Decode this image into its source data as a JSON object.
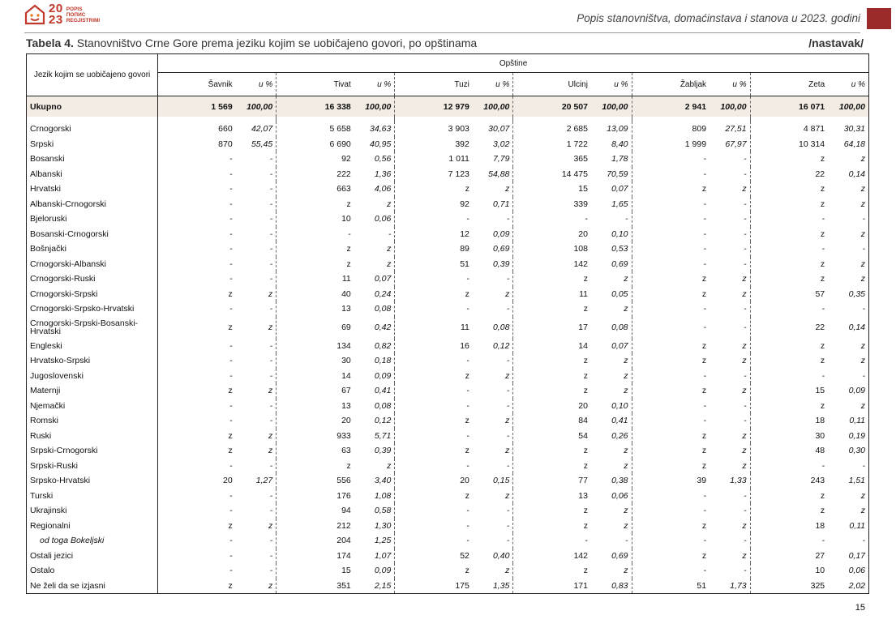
{
  "logo": {
    "year_top": "20",
    "year_bottom": "23",
    "words": [
      "POPIS",
      "ПОПИС",
      "REGJISTRIMI"
    ]
  },
  "header": {
    "title": "Popis stanovništva, domaćinstava i stanova u 2023. godini"
  },
  "table_title": {
    "label": "Tabela 4.",
    "text": " Stanovništvo Crne Gore prema jeziku kojim se uobičajeno govori, po opštinama",
    "continuation": "/nastavak/"
  },
  "table": {
    "lang_header": "Jezik kojim se uobičajeno govori",
    "group_header": "Opštine",
    "pct_label": "u %",
    "municipalities": [
      "Šavnik",
      "Tivat",
      "Tuzi",
      "Ulcinj",
      "Žabljak",
      "Zeta"
    ],
    "total": {
      "label": "Ukupno",
      "cells": [
        "1 569",
        "100,00",
        "16 338",
        "100,00",
        "12 979",
        "100,00",
        "20 507",
        "100,00",
        "2 941",
        "100,00",
        "16 071",
        "100,00"
      ]
    },
    "rows": [
      {
        "label": "Crnogorski",
        "cells": [
          "660",
          "42,07",
          "5 658",
          "34,63",
          "3 903",
          "30,07",
          "2 685",
          "13,09",
          "809",
          "27,51",
          "4 871",
          "30,31"
        ]
      },
      {
        "label": "Srpski",
        "cells": [
          "870",
          "55,45",
          "6 690",
          "40,95",
          "392",
          "3,02",
          "1 722",
          "8,40",
          "1 999",
          "67,97",
          "10 314",
          "64,18"
        ]
      },
      {
        "label": "Bosanski",
        "cells": [
          "-",
          "-",
          "92",
          "0,56",
          "1 011",
          "7,79",
          "365",
          "1,78",
          "-",
          "-",
          "z",
          "z"
        ]
      },
      {
        "label": "Albanski",
        "cells": [
          "-",
          "-",
          "222",
          "1,36",
          "7 123",
          "54,88",
          "14 475",
          "70,59",
          "-",
          "-",
          "22",
          "0,14"
        ]
      },
      {
        "label": "Hrvatski",
        "cells": [
          "-",
          "-",
          "663",
          "4,06",
          "z",
          "z",
          "15",
          "0,07",
          "z",
          "z",
          "z",
          "z"
        ]
      },
      {
        "label": "Albanski-Crnogorski",
        "cells": [
          "-",
          "-",
          "z",
          "z",
          "92",
          "0,71",
          "339",
          "1,65",
          "-",
          "-",
          "z",
          "z"
        ]
      },
      {
        "label": "Bjeloruski",
        "cells": [
          "-",
          "-",
          "10",
          "0,06",
          "-",
          "-",
          "-",
          "-",
          "-",
          "-",
          "-",
          "-"
        ]
      },
      {
        "label": "Bosanski-Crnogorski",
        "cells": [
          "-",
          "-",
          "-",
          "-",
          "12",
          "0,09",
          "20",
          "0,10",
          "-",
          "-",
          "z",
          "z"
        ]
      },
      {
        "label": "Bošnjački",
        "cells": [
          "-",
          "-",
          "z",
          "z",
          "89",
          "0,69",
          "108",
          "0,53",
          "-",
          "-",
          "-",
          "-"
        ]
      },
      {
        "label": "Crnogorski-Albanski",
        "cells": [
          "-",
          "-",
          "z",
          "z",
          "51",
          "0,39",
          "142",
          "0,69",
          "-",
          "-",
          "z",
          "z"
        ]
      },
      {
        "label": "Crnogorski-Ruski",
        "cells": [
          "-",
          "-",
          "11",
          "0,07",
          "-",
          "-",
          "z",
          "z",
          "z",
          "z",
          "z",
          "z"
        ]
      },
      {
        "label": "Crnogorski-Srpski",
        "cells": [
          "z",
          "z",
          "40",
          "0,24",
          "z",
          "z",
          "11",
          "0,05",
          "z",
          "z",
          "57",
          "0,35"
        ]
      },
      {
        "label": "Crnogorski-Srpsko-Hrvatski",
        "cells": [
          "-",
          "-",
          "13",
          "0,08",
          "-",
          "-",
          "z",
          "z",
          "-",
          "-",
          "-",
          "-"
        ]
      },
      {
        "label": "Crnogorski-Srpski-Bosanski-Hrvatski",
        "tall": true,
        "cells": [
          "z",
          "z",
          "69",
          "0,42",
          "11",
          "0,08",
          "17",
          "0,08",
          "-",
          "-",
          "22",
          "0,14"
        ]
      },
      {
        "label": "Engleski",
        "cells": [
          "-",
          "-",
          "134",
          "0,82",
          "16",
          "0,12",
          "14",
          "0,07",
          "z",
          "z",
          "z",
          "z"
        ]
      },
      {
        "label": "Hrvatsko-Srpski",
        "cells": [
          "-",
          "-",
          "30",
          "0,18",
          "-",
          "-",
          "z",
          "z",
          "z",
          "z",
          "z",
          "z"
        ]
      },
      {
        "label": "Jugoslovenski",
        "cells": [
          "-",
          "-",
          "14",
          "0,09",
          "z",
          "z",
          "z",
          "z",
          "-",
          "-",
          "-",
          "-"
        ]
      },
      {
        "label": "Maternji",
        "cells": [
          "z",
          "z",
          "67",
          "0,41",
          "-",
          "-",
          "z",
          "z",
          "z",
          "z",
          "15",
          "0,09"
        ]
      },
      {
        "label": "Njemački",
        "cells": [
          "-",
          "-",
          "13",
          "0,08",
          "-",
          "-",
          "20",
          "0,10",
          "-",
          "-",
          "z",
          "z"
        ]
      },
      {
        "label": "Romski",
        "cells": [
          "-",
          "-",
          "20",
          "0,12",
          "z",
          "z",
          "84",
          "0,41",
          "-",
          "-",
          "18",
          "0,11"
        ]
      },
      {
        "label": "Ruski",
        "cells": [
          "z",
          "z",
          "933",
          "5,71",
          "-",
          "-",
          "54",
          "0,26",
          "z",
          "z",
          "30",
          "0,19"
        ]
      },
      {
        "label": "Srpski-Crnogorski",
        "cells": [
          "z",
          "z",
          "63",
          "0,39",
          "z",
          "z",
          "z",
          "z",
          "z",
          "z",
          "48",
          "0,30"
        ]
      },
      {
        "label": "Srpski-Ruski",
        "cells": [
          "-",
          "-",
          "z",
          "z",
          "-",
          "-",
          "z",
          "z",
          "z",
          "z",
          "-",
          "-"
        ]
      },
      {
        "label": "Srpsko-Hrvatski",
        "cells": [
          "20",
          "1,27",
          "556",
          "3,40",
          "20",
          "0,15",
          "77",
          "0,38",
          "39",
          "1,33",
          "243",
          "1,51"
        ]
      },
      {
        "label": "Turski",
        "cells": [
          "-",
          "-",
          "176",
          "1,08",
          "z",
          "z",
          "13",
          "0,06",
          "-",
          "-",
          "z",
          "z"
        ]
      },
      {
        "label": "Ukrajinski",
        "cells": [
          "-",
          "-",
          "94",
          "0,58",
          "-",
          "-",
          "z",
          "z",
          "-",
          "-",
          "z",
          "z"
        ]
      },
      {
        "label": "Regionalni",
        "cells": [
          "z",
          "z",
          "212",
          "1,30",
          "-",
          "-",
          "z",
          "z",
          "z",
          "z",
          "18",
          "0,11"
        ]
      },
      {
        "label": "od toga Bokeljski",
        "sub": true,
        "cells": [
          "-",
          "-",
          "204",
          "1,25",
          "-",
          "-",
          "-",
          "-",
          "-",
          "-",
          "-",
          "-"
        ]
      },
      {
        "label": "Ostali jezici",
        "cells": [
          "-",
          "-",
          "174",
          "1,07",
          "52",
          "0,40",
          "142",
          "0,69",
          "z",
          "z",
          "27",
          "0,17"
        ]
      },
      {
        "label": "Ostalo",
        "cells": [
          "-",
          "-",
          "15",
          "0,09",
          "z",
          "z",
          "z",
          "z",
          "-",
          "-",
          "10",
          "0,06"
        ]
      },
      {
        "label": "Ne želi da se izjasni",
        "cells": [
          "z",
          "z",
          "351",
          "2,15",
          "175",
          "1,35",
          "171",
          "0,83",
          "51",
          "1,73",
          "325",
          "2,02"
        ]
      }
    ]
  },
  "page_number": "15",
  "colors": {
    "accent": "#c0392b",
    "header_block": "#9b2a2a",
    "total_row_bg": "#f2ece4"
  }
}
